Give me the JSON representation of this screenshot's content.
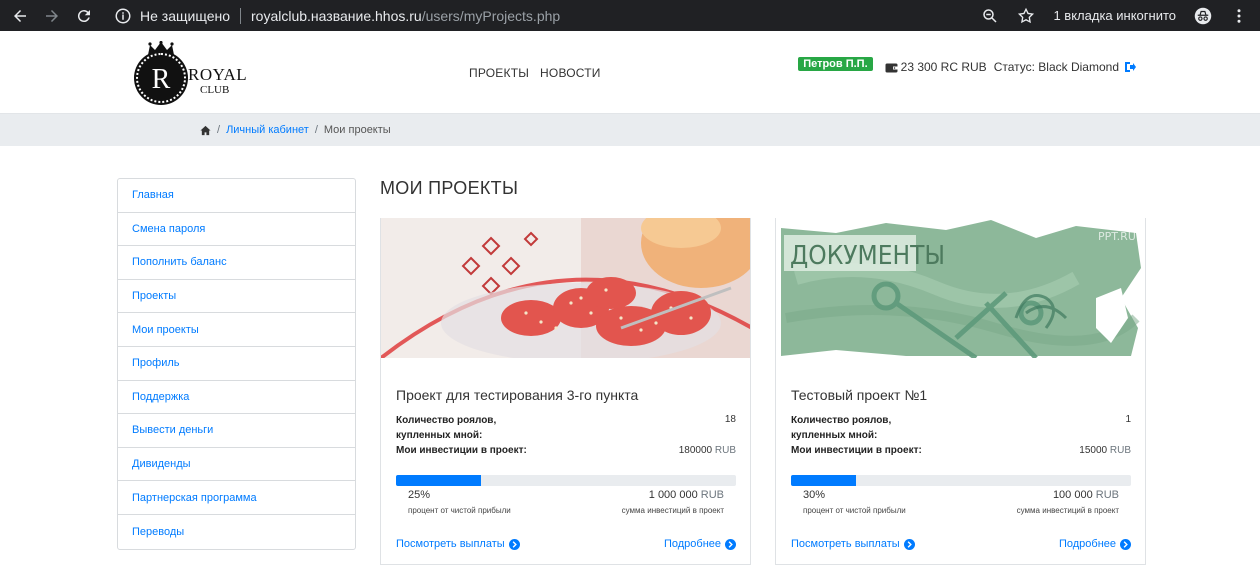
{
  "browser": {
    "insecure_label": "Не защищено",
    "url_host": "royalclub.название.hhos.ru",
    "url_path": "/users/myProjects.php",
    "incognito_label": "1 вкладка инкогнито"
  },
  "header": {
    "logo_letter": "R",
    "logo_royal": "ROYAL",
    "logo_club": "CLUB",
    "menu": [
      "ПРОЕКТЫ",
      "НОВОСТИ"
    ],
    "user_name": "Петров П.П.",
    "balance": "23 300 RC RUB",
    "status": "Статус: Black Diamond"
  },
  "breadcrumb": {
    "sep": "/",
    "link": "Личный кабинет",
    "current": "Мои проекты"
  },
  "sidebar": {
    "items": [
      "Главная",
      "Смена пароля",
      "Пополнить баланс",
      "Проекты",
      "Мои проекты",
      "Профиль",
      "Поддержка",
      "Вывести деньги",
      "Дивиденды",
      "Партнерская программа",
      "Переводы"
    ]
  },
  "page_title": "МОИ ПРОЕКТЫ",
  "cards": [
    {
      "title": "Проект для тестирования 3-го пункта",
      "royals_label_1": "Количество роялов,",
      "royals_label_2": "купленных мной:",
      "royals_value": "18",
      "invest_label": "Мои инвестиции в проект:",
      "invest_value": "180000",
      "invest_currency": "RUB",
      "progress_percent": 25,
      "percent_text": "25%",
      "percent_label": "процент от чистой прибыли",
      "sum_value": "1 000 000",
      "sum_currency": "RUB",
      "sum_label": "сумма инвестиций в проект",
      "payouts_link": "Посмотреть выплаты",
      "details_link": "Подробнее"
    },
    {
      "title": "Тестовый проект №1",
      "royals_label_1": "Количество роялов,",
      "royals_label_2": "купленных мной:",
      "royals_value": "1",
      "invest_label": "Мои инвестиции в проект:",
      "invest_value": "15000",
      "invest_currency": "RUB",
      "progress_percent": 19,
      "percent_text": "30%",
      "percent_label": "процент от чистой прибыли",
      "sum_value": "100 000",
      "sum_currency": "RUB",
      "sum_label": "сумма инвестиций в проект",
      "payouts_link": "Посмотреть выплаты",
      "details_link": "Подробнее",
      "image_text": "ДОКУМЕНТЫ",
      "image_watermark": "PPT.RU"
    }
  ],
  "colors": {
    "primary": "#007bff",
    "success": "#28a745",
    "chrome": "#202124"
  }
}
